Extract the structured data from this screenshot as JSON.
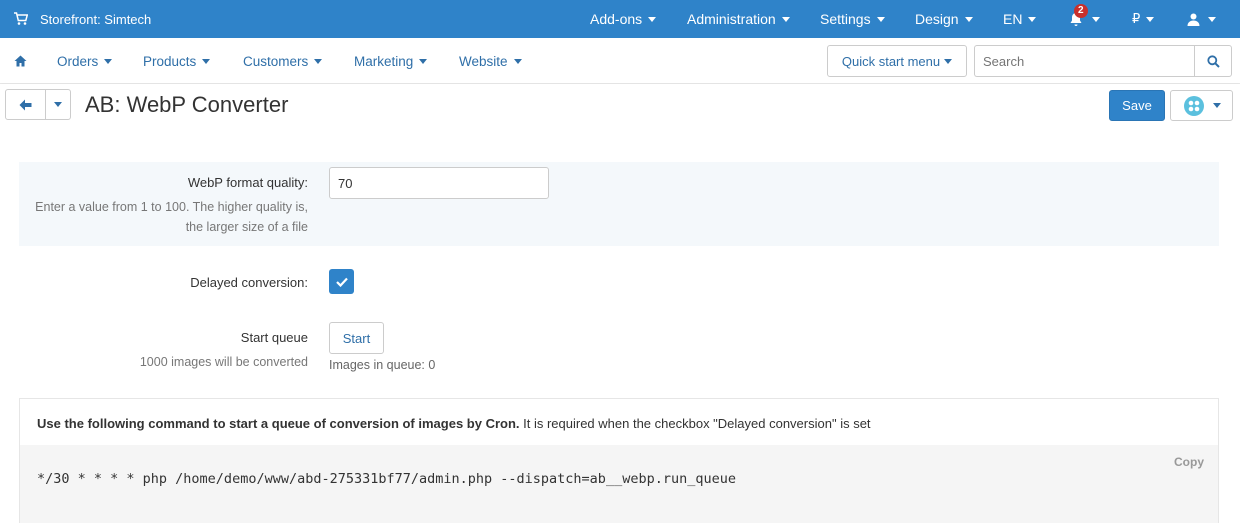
{
  "topbar": {
    "store_label": "Storefront: Simtech",
    "menus": [
      "Add-ons",
      "Administration",
      "Settings",
      "Design",
      "EN"
    ],
    "notification_count": "2",
    "currency": "₽"
  },
  "nav": {
    "items": [
      "Orders",
      "Products",
      "Customers",
      "Marketing",
      "Website"
    ],
    "quick_start": "Quick start menu",
    "search_placeholder": "Search"
  },
  "page": {
    "title": "AB: WebP Converter",
    "save_label": "Save"
  },
  "settings": {
    "quality_label": "WebP format quality:",
    "quality_value": "70",
    "quality_hint": "Enter a value from 1 to 100. The higher quality is, the larger size of a file",
    "delayed_label": "Delayed conversion:",
    "start_queue_label": "Start queue",
    "start_queue_hint": "1000 images will be converted",
    "start_button": "Start",
    "images_in_queue": "Images in queue: 0"
  },
  "cron": {
    "note_bold": "Use the following command to start a queue of conversion of images by Cron.",
    "note_rest": " It is required when the checkbox \"Delayed conversion\" is set",
    "command": "*/30 * * * * php /home/demo/www/abd-275331bf77/admin.php --dispatch=ab__webp.run_queue",
    "copy_label": "Copy"
  },
  "colors": {
    "topbar": "#2f83c9",
    "link": "#2f6fa8",
    "badge": "#c9302c"
  }
}
